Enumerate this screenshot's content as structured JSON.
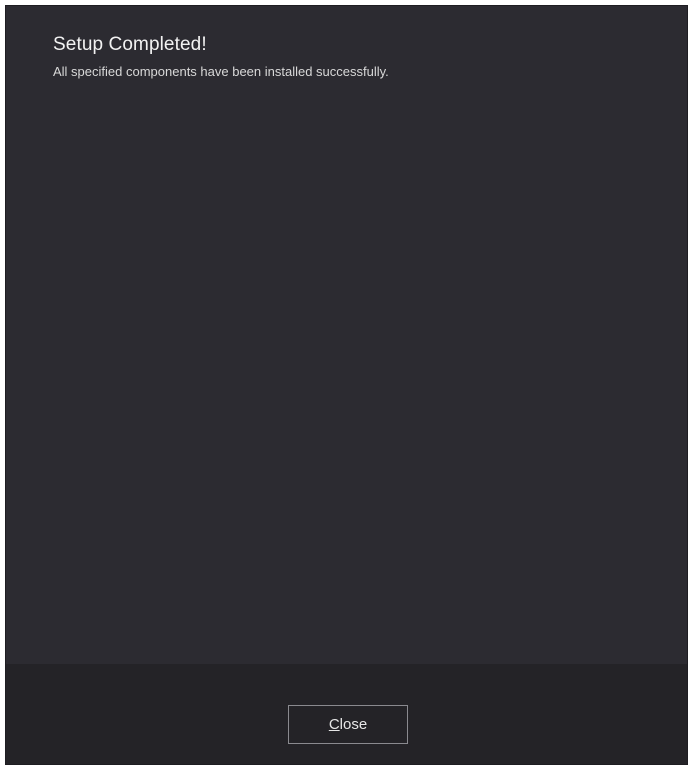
{
  "header": {
    "title": "Setup Completed!",
    "subtitle": "All specified components have been installed successfully."
  },
  "footer": {
    "close_button": {
      "mnemonic": "C",
      "rest": "lose"
    }
  },
  "colors": {
    "window_background": "#2c2b31",
    "footer_background": "#242327",
    "button_border": "#8a8a8f",
    "text_primary": "#f2f2f2"
  }
}
